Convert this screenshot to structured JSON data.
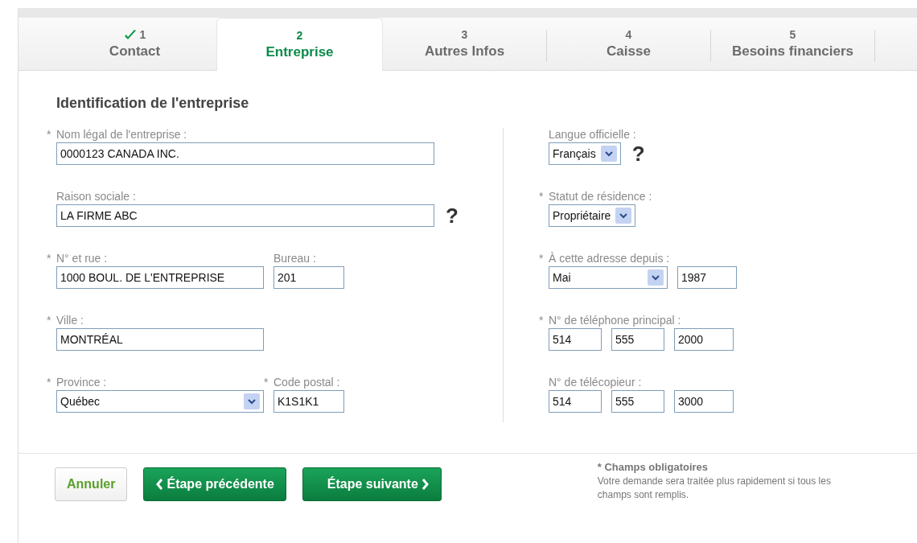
{
  "tabs": [
    {
      "number": "1",
      "label": "Contact",
      "selected": false,
      "completed": true
    },
    {
      "number": "2",
      "label": "Entreprise",
      "selected": true,
      "completed": false
    },
    {
      "number": "3",
      "label": "Autres Infos",
      "selected": false,
      "completed": false
    },
    {
      "number": "4",
      "label": "Caisse",
      "selected": false,
      "completed": false
    },
    {
      "number": "5",
      "label": "Besoins financiers",
      "selected": false,
      "completed": false
    }
  ],
  "section_title": "Identification de l'entreprise",
  "left_column": [
    {
      "fields": [
        {
          "required_mark": "*",
          "label": "Nom légal de l'entreprise :",
          "kind": "text",
          "value": "0000123 CANADA INC."
        }
      ]
    },
    {
      "fields": [
        {
          "label": "Raison sociale :",
          "kind": "text",
          "value": "LA FIRME ABC",
          "help": "?"
        }
      ]
    },
    {
      "fields": [
        {
          "required_mark": "*",
          "label": "N° et rue :",
          "kind": "text",
          "value": "1000 BOUL. DE L'ENTREPRISE"
        },
        {
          "label": "Bureau :",
          "kind": "text",
          "value": "201"
        }
      ]
    },
    {
      "fields": [
        {
          "required_mark": "*",
          "label": "Ville :",
          "kind": "text",
          "value": "MONTRÉAL"
        }
      ]
    },
    {
      "fields": [
        {
          "required_mark": "*",
          "label": "Province :",
          "kind": "select",
          "value": "Québec"
        },
        {
          "required_mark": "*",
          "label": "Code postal :",
          "kind": "text",
          "value": "K1S1K1"
        }
      ]
    }
  ],
  "right_column": [
    {
      "fields": [
        {
          "label": "Langue officielle :",
          "kind": "select",
          "value": "Français",
          "help": "?"
        }
      ]
    },
    {
      "fields": [
        {
          "required_mark": "*",
          "label": "Statut de résidence :",
          "kind": "select",
          "value": "Propriétaire"
        }
      ]
    },
    {
      "fields": [
        {
          "required_mark": "*",
          "label": "À cette adresse depuis :",
          "kind": "select",
          "value": "Mai"
        },
        {
          "kind": "text",
          "value": "1987"
        }
      ]
    },
    {
      "fields": [
        {
          "required_mark": "*",
          "label": "N° de téléphone principal :",
          "kind": "text",
          "value": "514"
        },
        {
          "kind": "text",
          "value": "555"
        },
        {
          "kind": "text",
          "value": "2000"
        }
      ]
    },
    {
      "fields": [
        {
          "label": "N° de télécopieur :",
          "kind": "text",
          "value": "514"
        },
        {
          "kind": "text",
          "value": "555"
        },
        {
          "kind": "text",
          "value": "3000"
        }
      ]
    }
  ],
  "buttons": [
    {
      "label": "Annuler",
      "kind": "cancel"
    },
    {
      "label": "Étape précédente",
      "kind": "previous"
    },
    {
      "label": "Étape suivante",
      "kind": "next"
    }
  ],
  "note": {
    "title": "* Champs obligatoires",
    "text": "Votre demande sera traitée plus rapidement si tous les champs sont remplis."
  }
}
